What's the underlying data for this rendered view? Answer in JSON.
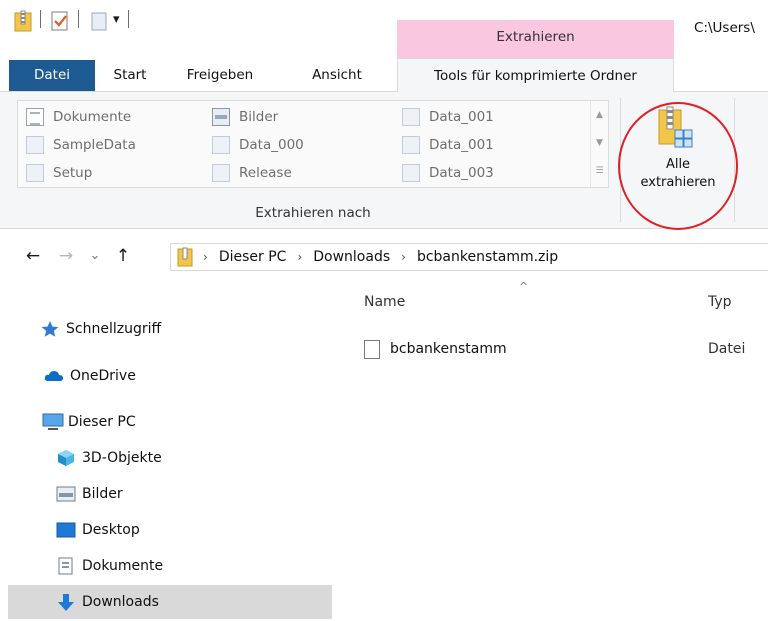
{
  "title": {
    "context_header": "Extrahieren",
    "path": "C:\\Users\\"
  },
  "quick_access_toolbar": {
    "icons": [
      "zip-folder-icon",
      "properties-check-icon",
      "new-folder-icon",
      "customize-dropdown-icon"
    ],
    "dropdown_glyph": "▾"
  },
  "tabs": {
    "file": "Datei",
    "start": "Start",
    "share": "Freigeben",
    "view": "Ansicht",
    "compressed_tools": "Tools für komprimierte Ordner"
  },
  "ribbon": {
    "gallery": {
      "col1": [
        {
          "label": "Dokumente",
          "icon": "documents-icon"
        },
        {
          "label": "SampleData",
          "icon": "file-icon"
        },
        {
          "label": "Setup",
          "icon": "file-icon"
        }
      ],
      "col2": [
        {
          "label": "Bilder",
          "icon": "pictures-icon"
        },
        {
          "label": "Data_000",
          "icon": "file-icon"
        },
        {
          "label": "Release",
          "icon": "file-icon"
        }
      ],
      "col3": [
        {
          "label": "Data_001",
          "icon": "file-icon"
        },
        {
          "label": "Data_001",
          "icon": "file-icon"
        },
        {
          "label": "Data_003",
          "icon": "file-icon"
        }
      ]
    },
    "group_label": "Extrahieren nach",
    "extract_all_line1": "Alle",
    "extract_all_line2": "extrahieren",
    "highlight_color": "#e01f25"
  },
  "addressbar": {
    "back": "←",
    "forward": "→",
    "recent": "⌄",
    "up": "↑",
    "crumbs": [
      "Dieser PC",
      "Downloads",
      "bcbankenstamm.zip"
    ],
    "sep": "›"
  },
  "navpane": {
    "quick_access": "Schnellzugriff",
    "onedrive": "OneDrive",
    "this_pc": "Dieser PC",
    "objects3d": "3D-Objekte",
    "pictures": "Bilder",
    "desktop": "Desktop",
    "documents": "Dokumente",
    "downloads": "Downloads"
  },
  "content": {
    "columns": {
      "name": "Name",
      "type": "Typ"
    },
    "sort_glyph": "^",
    "files": [
      {
        "name": "bcbankenstamm",
        "type": "Datei"
      }
    ]
  },
  "colors": {
    "file_tab": "#1d5a91",
    "context_tab": "#f9c7e0",
    "folder": "#f1c64a"
  }
}
